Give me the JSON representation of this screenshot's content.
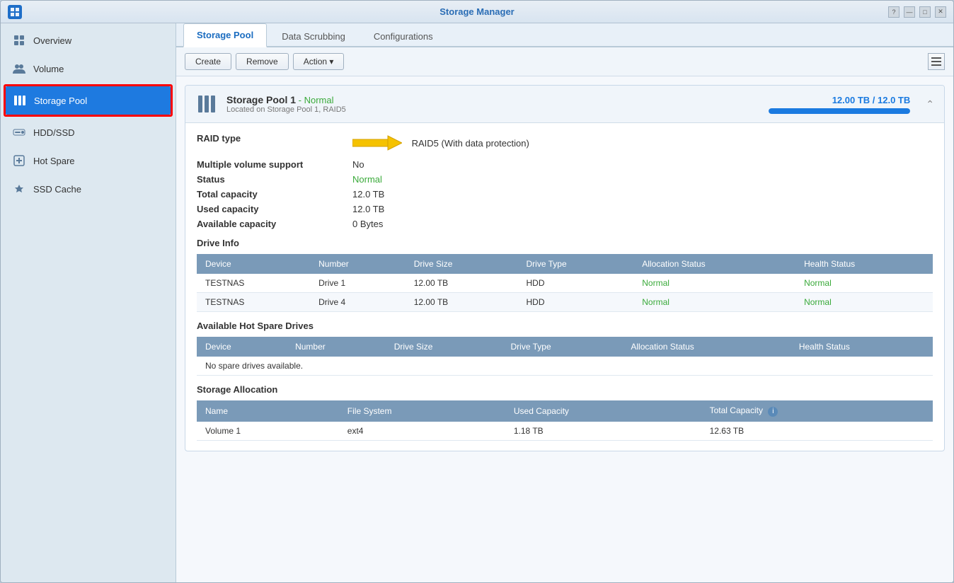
{
  "window": {
    "title": "Storage Manager",
    "app_icon": "💾"
  },
  "title_bar": {
    "controls": [
      "?",
      "—",
      "□",
      "✕"
    ]
  },
  "sidebar": {
    "items": [
      {
        "id": "overview",
        "label": "Overview",
        "icon": "grid"
      },
      {
        "id": "volume",
        "label": "Volume",
        "icon": "users"
      },
      {
        "id": "storage-pool",
        "label": "Storage Pool",
        "icon": "bars",
        "active": true
      },
      {
        "id": "hdd-ssd",
        "label": "HDD/SSD",
        "icon": "circle"
      },
      {
        "id": "hot-spare",
        "label": "Hot Spare",
        "icon": "plus-square"
      },
      {
        "id": "ssd-cache",
        "label": "SSD Cache",
        "icon": "lightning"
      }
    ]
  },
  "tabs": [
    {
      "id": "storage-pool",
      "label": "Storage Pool",
      "active": true
    },
    {
      "id": "data-scrubbing",
      "label": "Data Scrubbing"
    },
    {
      "id": "configurations",
      "label": "Configurations"
    }
  ],
  "toolbar": {
    "create_label": "Create",
    "remove_label": "Remove",
    "action_label": "Action ▾"
  },
  "pool": {
    "name": "Storage Pool 1",
    "status_label": "- Normal",
    "location": "Located on Storage Pool 1, RAID5",
    "capacity_text": "12.00 TB / 12.0  TB",
    "capacity_percent": 100,
    "details": {
      "raid_type_label": "RAID type",
      "raid_type_value": "RAID5  (With data protection)",
      "multiple_volume_label": "Multiple volume support",
      "multiple_volume_value": "No",
      "status_label": "Status",
      "status_value": "Normal",
      "total_capacity_label": "Total capacity",
      "total_capacity_value": "12.0  TB",
      "used_capacity_label": "Used capacity",
      "used_capacity_value": "12.0  TB",
      "available_capacity_label": "Available capacity",
      "available_capacity_value": "0 Bytes"
    },
    "drive_info": {
      "section_title": "Drive Info",
      "columns": [
        "Device",
        "Number",
        "Drive Size",
        "Drive Type",
        "Allocation Status",
        "Health Status"
      ],
      "rows": [
        {
          "device": "TESTNAS",
          "number": "Drive 1",
          "drive_size": "12.00 TB",
          "drive_type": "HDD",
          "allocation_status": "Normal",
          "health_status": "Normal"
        },
        {
          "device": "TESTNAS",
          "number": "Drive 4",
          "drive_size": "12.00 TB",
          "drive_type": "HDD",
          "allocation_status": "Normal",
          "health_status": "Normal"
        }
      ]
    },
    "hot_spare": {
      "section_title": "Available Hot Spare Drives",
      "columns": [
        "Device",
        "Number",
        "Drive Size",
        "Drive Type",
        "Allocation Status",
        "Health Status"
      ],
      "empty_message": "No spare drives available."
    },
    "storage_allocation": {
      "section_title": "Storage Allocation",
      "columns": [
        "Name",
        "File System",
        "Used Capacity",
        "Total Capacity"
      ],
      "rows": [
        {
          "name": "Volume 1",
          "file_system": "ext4",
          "used_capacity": "1.18 TB",
          "total_capacity": "12.63 TB"
        }
      ]
    }
  }
}
